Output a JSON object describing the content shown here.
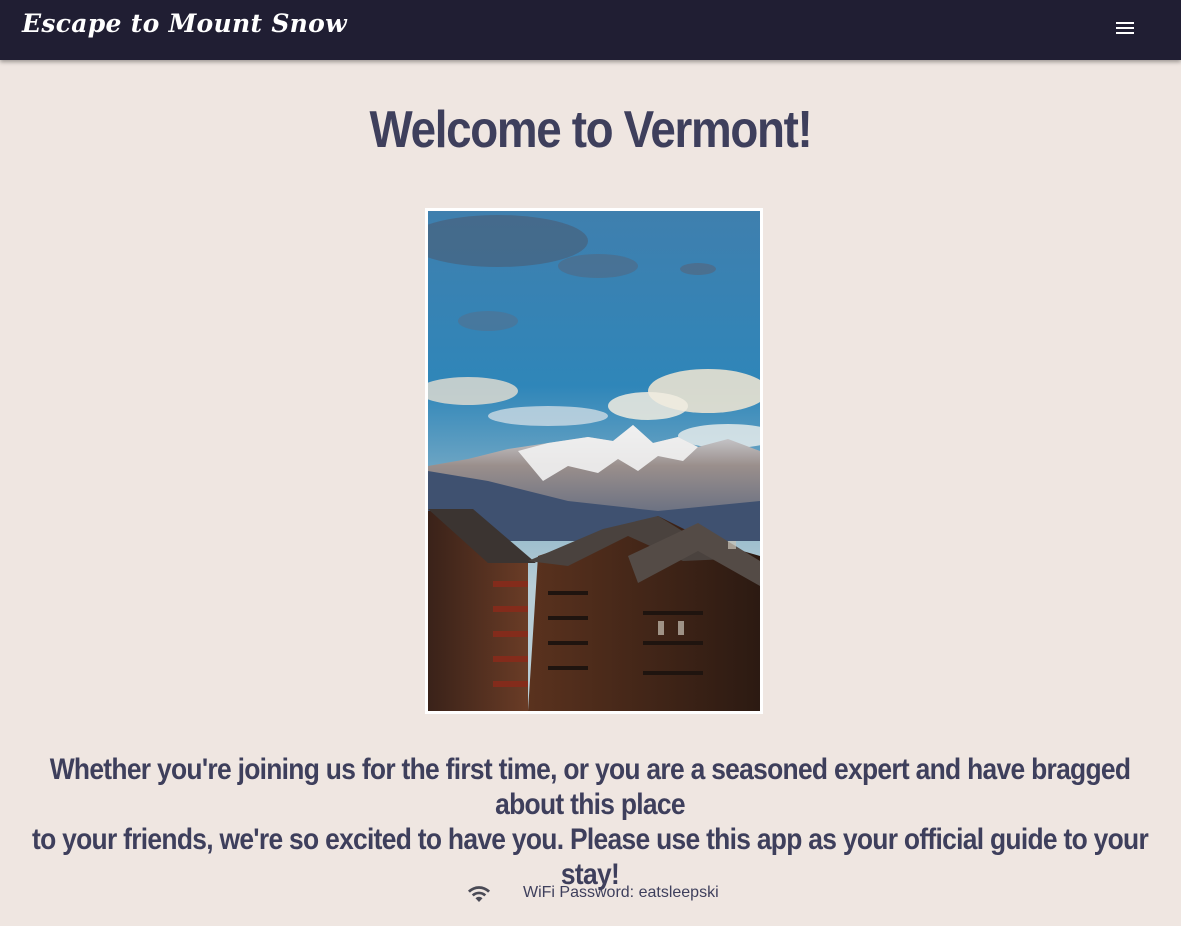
{
  "appbar": {
    "title": "Escape to Mount Snow",
    "menu_icon": "menu-icon",
    "background": "#201e33"
  },
  "main": {
    "heading": "Welcome to Vermont!",
    "photo": {
      "icon": "mountain-chalet-photo"
    },
    "intro_line1": "Whether you're joining us for the first time, or you are a seasoned expert and have bragged about this place",
    "intro_line2": "to your friends, we're so excited to have you. Please use this app as your official guide to your stay!",
    "text_color": "#3e3f5c"
  },
  "footer": {
    "wifi_icon": "wifi-icon",
    "wifi_text": "WiFi Password: eatsleepski"
  },
  "colors": {
    "page_background": "#efe6e1",
    "appbar": "#201e33",
    "heading": "#3e3f5c"
  }
}
